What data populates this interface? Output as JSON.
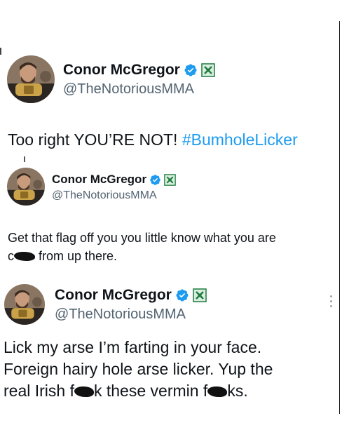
{
  "tweets": [
    {
      "display_name": "Conor McGregor",
      "handle": "@TheNotoriousMMA",
      "text": "Too right YOU’RE NOT! ",
      "hashtag": "#BumholeLicker"
    },
    {
      "display_name": "Conor McGregor",
      "handle": "@TheNotoriousMMA",
      "line1": "Get that flag off you you little know what you are",
      "line2_prefix": "c",
      "line2_suffix": " from up there."
    },
    {
      "display_name": "Conor McGregor",
      "handle": "@TheNotoriousMMA",
      "line1": "Lick my arse I’m farting in your face.",
      "line2": "Foreign hairy hole arse licker. Yup the",
      "line3_a": "real Irish f",
      "line3_b": "k these vermin f",
      "line3_c": "ks."
    }
  ],
  "icons": {
    "verified": "verified-badge-icon",
    "affiliate": "affiliate-badge-icon",
    "more": "more-options-icon"
  },
  "colors": {
    "verified": "#1d9bf0",
    "affiliate": "#1f7a3d",
    "hashtag": "#1d9bf0",
    "handle": "#536471"
  }
}
